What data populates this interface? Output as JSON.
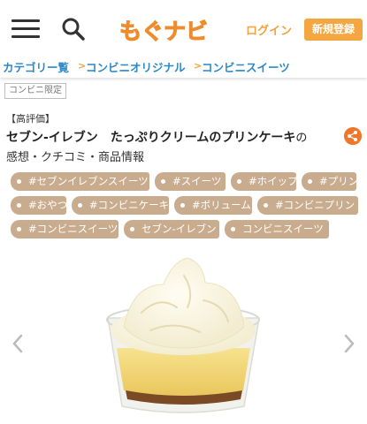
{
  "header": {
    "menu_icon": "hamburger-menu-icon",
    "search_icon": "search-icon",
    "logo_text": "もぐナビ",
    "login_label": "ログイン",
    "register_label": "新規登録",
    "colors": {
      "accent": "#f4a640",
      "logo_orange": "#ef8b2c",
      "link_blue": "#2c88c6"
    }
  },
  "breadcrumb": {
    "items": [
      {
        "label": "カテゴリー覧"
      },
      {
        "label": "コンビニオリジナル"
      },
      {
        "label": "コンビニスイーツ"
      }
    ],
    "separator": ">"
  },
  "product": {
    "badge": "コンビニ限定",
    "rating_label": "【高評価】",
    "title": "セブン-イレブン　たっぷりクリームのプリンケーキ",
    "title_suffix": "の",
    "subtitle": "感想・クチコミ・商品情報",
    "share_icon": "share-icon"
  },
  "tags": [
    "#セブンイレブンスイーツ",
    "#スイーツ",
    "#ホイップ",
    "#プリン",
    "#おやつ",
    "#コンビニケーキ",
    "#ボリューム",
    "#コンビニプリン",
    "#コンビニスイーツ",
    "セブン-イレブン",
    "コンビニスイーツ"
  ],
  "gallery": {
    "prev_icon": "chevron-left-icon",
    "next_icon": "chevron-right-icon"
  }
}
